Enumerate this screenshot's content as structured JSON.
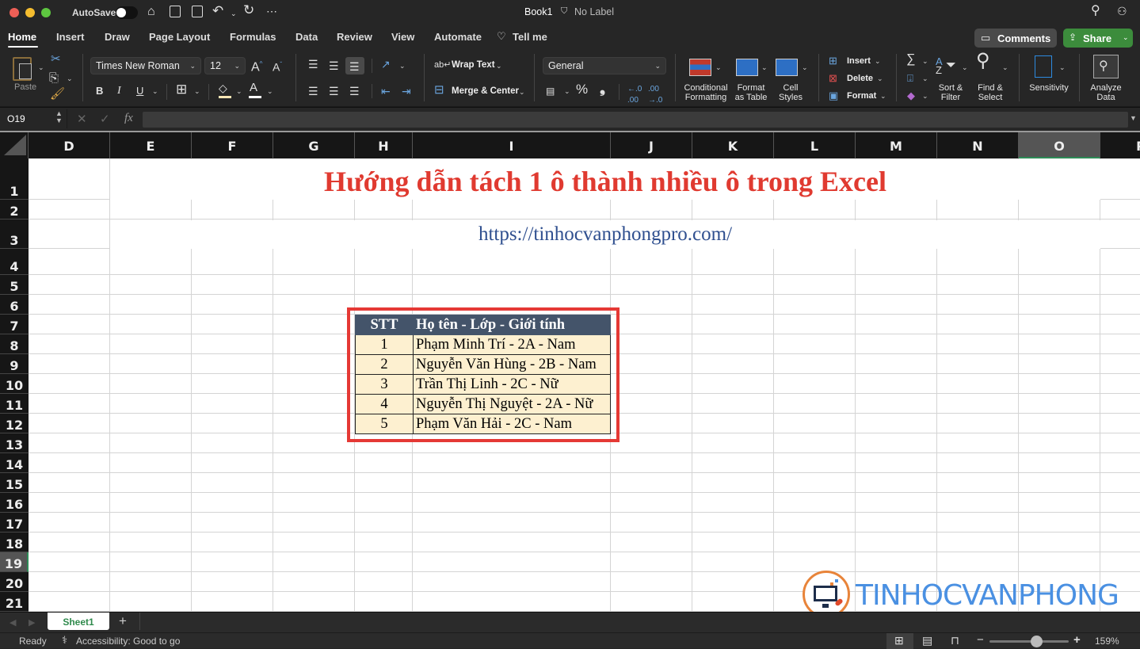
{
  "window": {
    "title": "Book1",
    "label": "No Label",
    "autosave_label": "AutoSave"
  },
  "tabs": [
    "Home",
    "Insert",
    "Draw",
    "Page Layout",
    "Formulas",
    "Data",
    "Review",
    "View",
    "Automate"
  ],
  "tell_me": "Tell me",
  "buttons": {
    "comments": "Comments",
    "share": "Share"
  },
  "ribbon": {
    "paste": "Paste",
    "font_name": "Times New Roman",
    "font_size": "12",
    "bold": "B",
    "italic": "I",
    "underline": "U",
    "wrap_text": "Wrap Text",
    "merge_center": "Merge & Center",
    "number_format": "General",
    "percent": "%",
    "comma": "❟",
    "conditional_formatting": [
      "Conditional",
      "Formatting"
    ],
    "format_as_table": [
      "Format",
      "as Table"
    ],
    "cell_styles": [
      "Cell",
      "Styles"
    ],
    "insert": "Insert",
    "delete": "Delete",
    "format": "Format",
    "sort_filter": [
      "Sort &",
      "Filter"
    ],
    "find_select": [
      "Find &",
      "Select"
    ],
    "sensitivity": "Sensitivity",
    "analyze_data": [
      "Analyze",
      "Data"
    ]
  },
  "formula_bar": {
    "name_box": "O19",
    "fx": "fx",
    "content": ""
  },
  "columns": [
    "D",
    "E",
    "F",
    "G",
    "H",
    "I",
    "J",
    "K",
    "L",
    "M",
    "N",
    "O",
    "P"
  ],
  "selected_column": "O",
  "rows": [
    "1",
    "2",
    "3",
    "4",
    "5",
    "6",
    "7",
    "8",
    "9",
    "10",
    "11",
    "12",
    "13",
    "14",
    "15",
    "16",
    "17",
    "18",
    "19",
    "20",
    "21"
  ],
  "selected_row": "19",
  "sheet": {
    "title": "Hướng dẫn tách 1 ô thành nhiều ô trong Excel",
    "url": "https://tinhocvanphongpro.com/",
    "table": {
      "headers": [
        "STT",
        "Họ tên - Lớp - Giới tính"
      ],
      "rows": [
        [
          "1",
          "Phạm Minh Trí - 2A - Nam"
        ],
        [
          "2",
          "Nguyễn Văn Hùng - 2B - Nam"
        ],
        [
          "3",
          "Trần Thị Linh - 2C - Nữ"
        ],
        [
          "4",
          "Nguyễn Thị Nguyệt - 2A - Nữ"
        ],
        [
          "5",
          "Phạm Văn Hải - 2C - Nam"
        ]
      ]
    },
    "watermark": "TINHOCVANPHONG"
  },
  "sheet_tabs": [
    "Sheet1"
  ],
  "status": {
    "ready": "Ready",
    "accessibility": "Accessibility: Good to go",
    "zoom": "159%",
    "zoom_level": 0.59
  },
  "colors": {
    "title_red": "#e03a30",
    "url_blue": "#2f4f8f",
    "table_header_bg": "#44546a",
    "table_row_bg": "#fdf0d0",
    "highlight_border": "#e53935",
    "share_green": "#3c8c3c",
    "watermark_blue": "#4a90e2"
  }
}
